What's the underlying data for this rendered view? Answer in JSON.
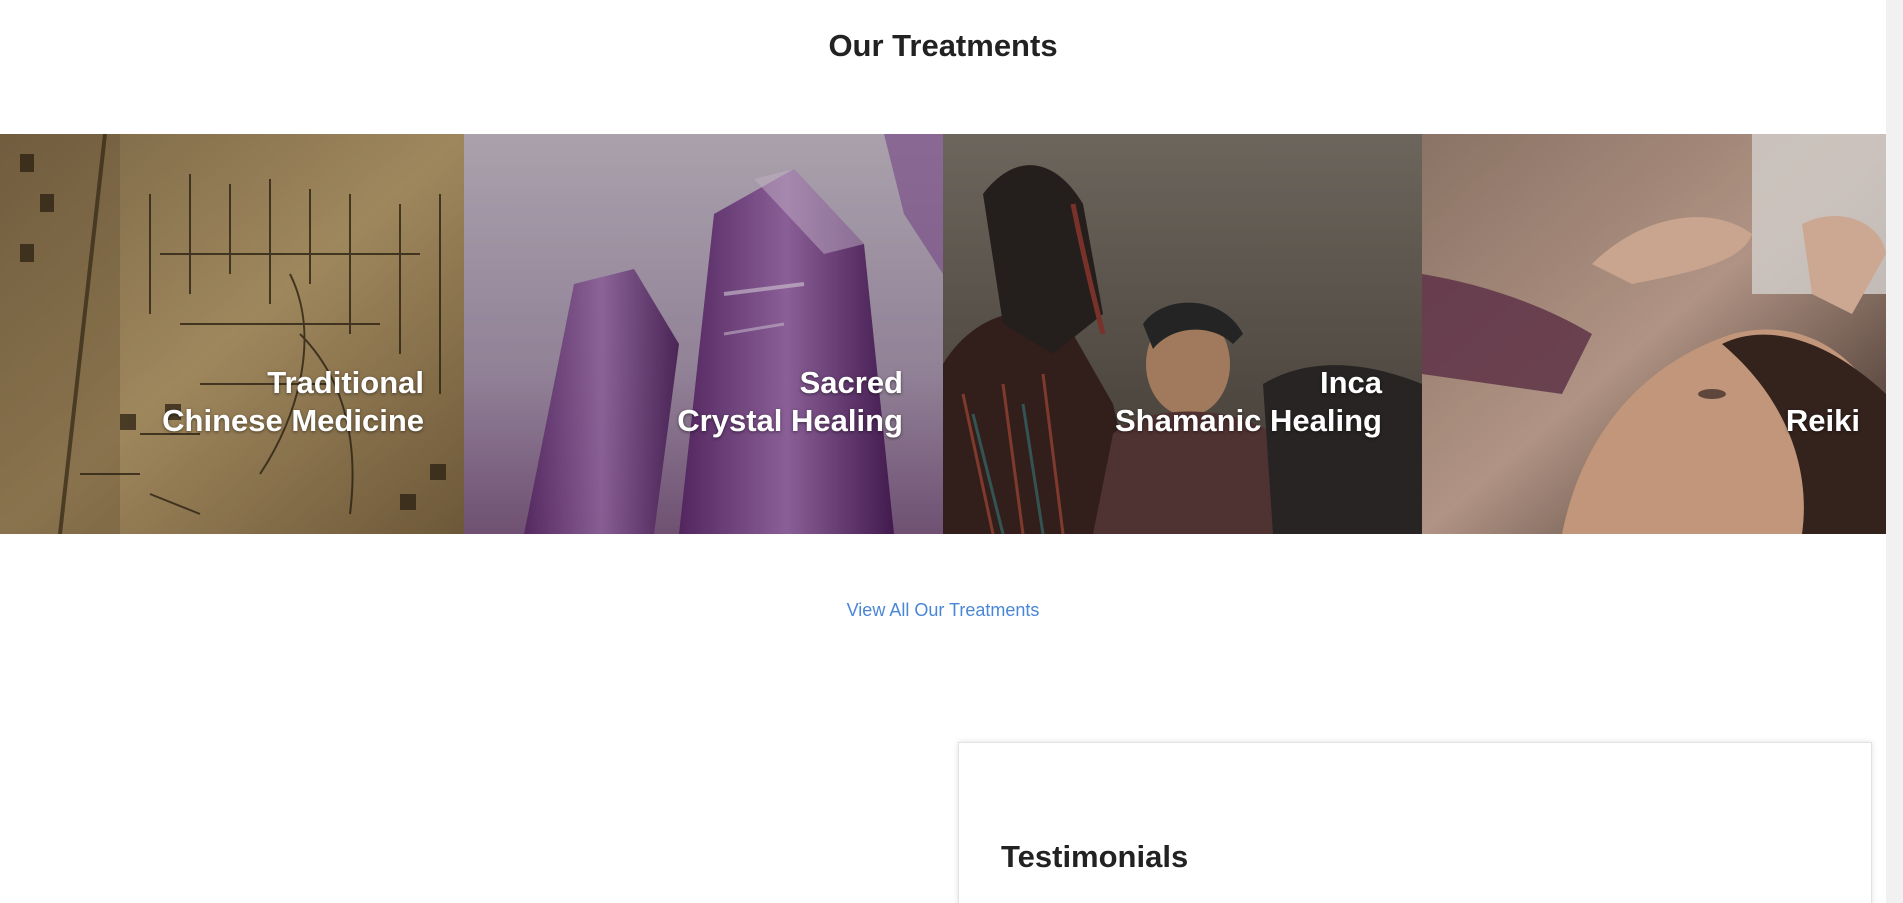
{
  "treatments": {
    "heading": "Our Treatments",
    "tiles": [
      {
        "line1": "Traditional",
        "line2": "Chinese Medicine",
        "image": "chinese-medicine-book-image"
      },
      {
        "line1": "Sacred",
        "line2": "Crystal Healing",
        "image": "amethyst-crystals-image"
      },
      {
        "line1": "Inca",
        "line2": "Shamanic Healing",
        "image": "shaman-ritual-image"
      },
      {
        "line1": "",
        "line2": "Reiki",
        "image": "reiki-hands-image"
      }
    ],
    "view_all_label": "View All Our Treatments"
  },
  "testimonials": {
    "heading": "Testimonials"
  },
  "colors": {
    "link": "#4a86d8",
    "heading": "#222222"
  }
}
